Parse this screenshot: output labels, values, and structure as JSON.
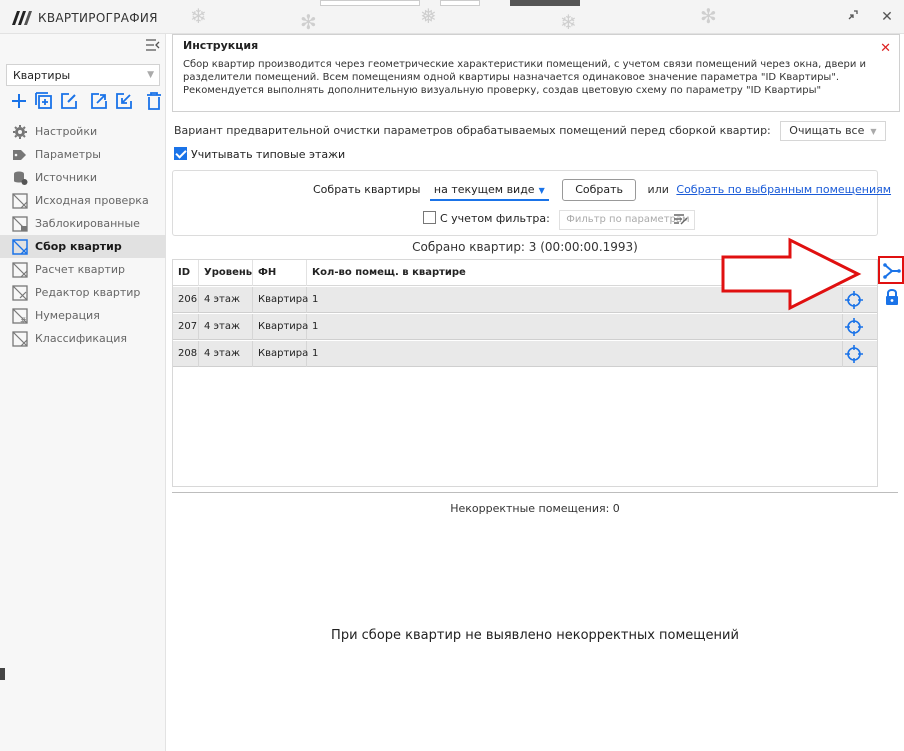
{
  "app": {
    "title": "КВАРТИРОГРАФИЯ"
  },
  "window": {
    "minimize_icon": "expand-icon",
    "close_icon": "close-icon"
  },
  "sidebar": {
    "mode_select": "Квартиры",
    "toolbar_icons": [
      "add-icon",
      "add-box-icon",
      "edit-icon",
      "export-icon",
      "import-icon",
      "delete-icon"
    ],
    "items": [
      {
        "label": "Настройки",
        "icon": "gear-icon"
      },
      {
        "label": "Параметры",
        "icon": "tag-icon"
      },
      {
        "label": "Источники",
        "icon": "database-icon"
      },
      {
        "label": "Исходная проверка",
        "icon": "check-plan-icon"
      },
      {
        "label": "Заблокированные",
        "icon": "lock-plan-icon"
      },
      {
        "label": "Сбор квартир",
        "icon": "collect-plan-icon",
        "active": true
      },
      {
        "label": "Расчет квартир",
        "icon": "calc-plan-icon"
      },
      {
        "label": "Редактор квартир",
        "icon": "edit-plan-icon"
      },
      {
        "label": "Нумерация",
        "icon": "number-plan-icon"
      },
      {
        "label": "Классификация",
        "icon": "classify-plan-icon"
      }
    ]
  },
  "instruction": {
    "title": "Инструкция",
    "text": "Сбор квартир производится через геометрические характеристики помещений, с учетом связи помещений через окна, двери и разделители помещений. Всем помещениям одной квартиры назначается одинаковое значение параметра \"ID Квартиры\". Рекомендуется выполнять дополнительную визуальную проверку, создав цветовую схему по параметру \"ID Квартиры\""
  },
  "cleanup": {
    "label": "Вариант предварительной очистки параметров обрабатываемых помещений перед сборкой квартир:",
    "value": "Очищать все"
  },
  "typical_floors": {
    "label": "Учитывать типовые этажи",
    "checked": true
  },
  "collect": {
    "label": "Собрать квартиры",
    "mode": "на текущем виде",
    "button": "Собрать",
    "or_text": "или",
    "selected_link": "Собрать по выбранным помещениям",
    "filter_label": "С учетом фильтра:",
    "filter_placeholder": "Фильтр по параметрам",
    "filter_checked": false
  },
  "status": {
    "collected": "Собрано квартир: 3 (00:00:00.1993)"
  },
  "table": {
    "headers": [
      "ID",
      "Уровень",
      "ФН",
      "Кол-во помещ. в квартире"
    ],
    "rows": [
      [
        "206",
        "4 этаж",
        "Квартира",
        "1"
      ],
      [
        "207",
        "4 этаж",
        "Квартира",
        "1"
      ],
      [
        "208",
        "4 этаж",
        "Квартира",
        "1"
      ]
    ]
  },
  "incorrect": {
    "title": "Некорректные помещения: 0",
    "empty_message": "При сборе квартир не выявлено некорректных помещений"
  },
  "colors": {
    "accent": "#1a73e8",
    "highlight": "#e01010",
    "active_nav": "#e1e1e1"
  }
}
